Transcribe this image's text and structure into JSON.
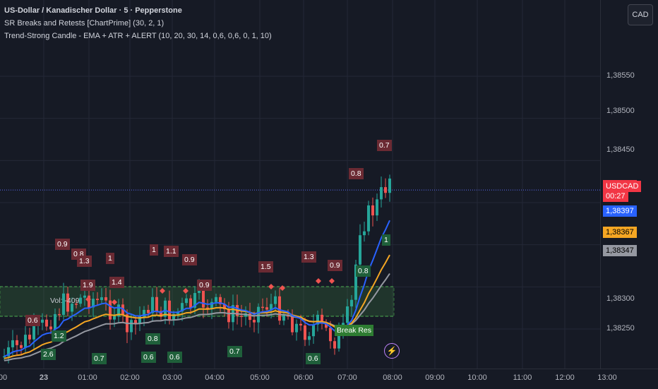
{
  "legend": {
    "symbol": "US-Dollar / Kanadischer Dollar · 5 · Pepperstone",
    "indicator1": "SR Breaks and Retests [ChartPrime] (30, 2, 1)",
    "indicator2": "Trend-Strong Candle - EMA + ATR + ALERT (10, 20, 30, 14, 0,6, 0,6, 0, 1, 10)"
  },
  "currency_button": "CAD",
  "price_axis": {
    "ticks": [
      "1,38550",
      "1,38500",
      "1,38450",
      "1,38300",
      "1,38250"
    ],
    "symbol_tag": "USDCAD",
    "last_price": "1,38415",
    "countdown": "00:27",
    "ema_fast": "1,38397",
    "ema_mid": "1,38367",
    "ema_slow": "1,38347"
  },
  "time_axis": {
    "ticks": [
      "00",
      "23",
      "01:00",
      "02:00",
      "03:00",
      "04:00",
      "05:00",
      "06:00",
      "07:00",
      "08:00",
      "09:00",
      "10:00",
      "11:00",
      "12:00",
      "13:00"
    ]
  },
  "zone_labels": {
    "vol": "Vol: -409",
    "break_res": "Break Res"
  },
  "colors": {
    "background": "#161a25",
    "bull": "#26a69a",
    "bear": "#ef5350",
    "ema_fast": "#2962ff",
    "ema_mid": "#f5a623",
    "ema_slow": "#9598a1",
    "zone": "#4caf50",
    "bear_label": "#6b2a33",
    "bull_label": "#1f5f3a"
  },
  "chart_data": {
    "type": "candlestick",
    "ylim": [
      1.3824,
      1.3858
    ],
    "bear_labels": [
      "0.9",
      "0.8",
      "1.3",
      "1",
      "1",
      "1.1",
      "0.9",
      "1.4",
      "1.9",
      "0.9",
      "1.5",
      "1.3",
      "0.9",
      "0.8",
      "0.7",
      "0.6"
    ],
    "bull_labels": [
      "1.2",
      "2.6",
      "0.7",
      "0.6",
      "0.8",
      "0.6",
      "0.7",
      "0.6",
      "0.8",
      "1"
    ],
    "current_price": 1.38415
  }
}
